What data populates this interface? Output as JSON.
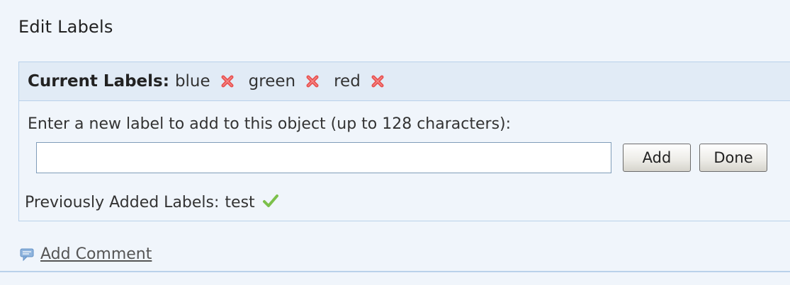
{
  "header": {
    "title": "Edit Labels"
  },
  "current_labels": {
    "heading": "Current Labels:",
    "items": [
      {
        "label": "blue"
      },
      {
        "label": "green"
      },
      {
        "label": "red"
      }
    ]
  },
  "form": {
    "instruction": "Enter a new label to add to this object (up to 128 characters):",
    "input_value": "",
    "add_label": "Add",
    "done_label": "Done"
  },
  "previous": {
    "label": "Previously Added Labels:",
    "value": "test"
  },
  "footer": {
    "comment_link": "Add Comment"
  },
  "colors": {
    "remove_icon": "#e8504f",
    "check_icon": "#7cc04b",
    "panel_header_bg": "#e1ebf6",
    "page_bg": "#f0f5fb",
    "border": "#b9d1ea"
  },
  "icons": {
    "remove": "close-icon",
    "confirmed": "check-icon",
    "comment": "speech-bubble-icon"
  }
}
